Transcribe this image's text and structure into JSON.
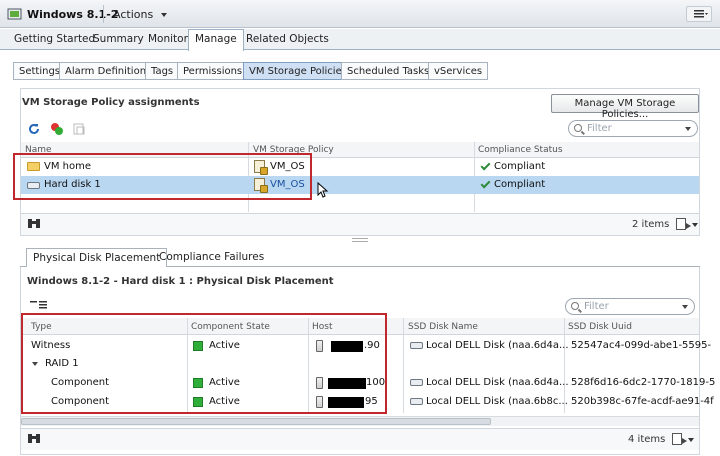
{
  "window": {
    "title": "Windows 8.1-2",
    "actions_label": "Actions"
  },
  "main_tabs": [
    "Getting Started",
    "Summary",
    "Monitor",
    "Manage",
    "Related Objects"
  ],
  "sub_tabs": [
    "Settings",
    "Alarm Definitions",
    "Tags",
    "Permissions",
    "VM Storage Policies",
    "Scheduled Tasks",
    "vServices"
  ],
  "assignments": {
    "title": "VM Storage Policy assignments",
    "manage_button": "Manage VM Storage Policies...",
    "filter_placeholder": "Filter",
    "columns": [
      "Name",
      "VM Storage Policy",
      "Compliance Status"
    ],
    "rows": [
      {
        "name": "VM home",
        "policy": "VM_OS",
        "status": "Compliant"
      },
      {
        "name": "Hard disk 1",
        "policy": "VM_OS",
        "status": "Compliant"
      }
    ],
    "item_count": "2 items"
  },
  "bottom_tabs": [
    "Physical Disk Placement",
    "Compliance Failures"
  ],
  "placement": {
    "title": "Windows 8.1-2 - Hard disk 1 : Physical Disk Placement",
    "filter_placeholder": "Filter",
    "columns": [
      "Type",
      "Component State",
      "Host",
      "SSD Disk Name",
      "SSD Disk Uuid"
    ],
    "rows": [
      {
        "type": "Witness",
        "state": "Active",
        "host_suffix": ".90",
        "ssd_name": "Local DELL Disk (naa.6d4a...",
        "ssd_uuid": "52547ac4-099d-abe1-5595-"
      },
      {
        "type": "RAID 1",
        "state": "",
        "host_suffix": "",
        "ssd_name": "",
        "ssd_uuid": ""
      },
      {
        "type": "Component",
        "state": "Active",
        "host_suffix": "100",
        "ssd_name": "Local DELL Disk (naa.6d4a...",
        "ssd_uuid": "528f6d16-6dc2-1770-1819-5"
      },
      {
        "type": "Component",
        "state": "Active",
        "host_suffix": "95",
        "ssd_name": "Local DELL Disk (naa.6b8c...",
        "ssd_uuid": "520b398c-67fe-acdf-ae91-4f"
      }
    ],
    "item_count": "4 items"
  },
  "colors": {
    "selected_row": "#b9d7f1",
    "active_subtab": "#cfe0f4",
    "highlight_border": "#c0282e",
    "active_green": "#2fae3a"
  }
}
